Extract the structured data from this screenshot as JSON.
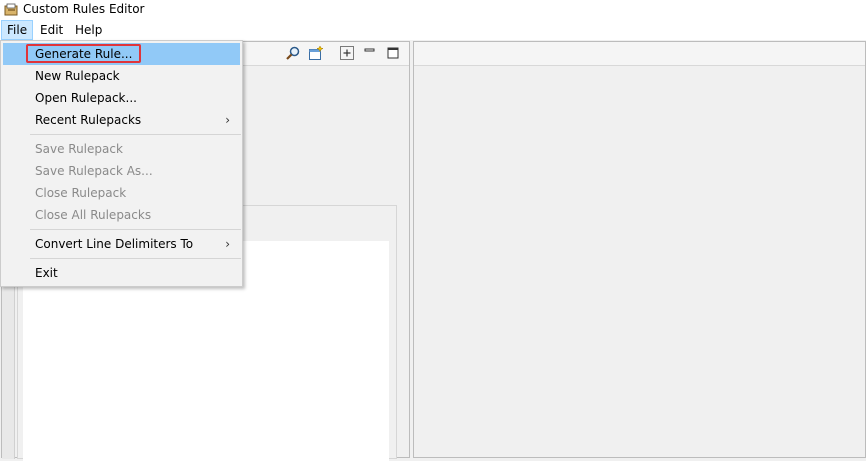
{
  "window": {
    "title": "Custom Rules Editor",
    "icon": "editor-app-icon"
  },
  "menubar": {
    "items": [
      "File",
      "Edit",
      "Help"
    ],
    "active": "File"
  },
  "toolbar": {
    "icons": [
      "search-icon",
      "new-window-icon",
      "maximize-icon",
      "minimize-icon",
      "restore-icon"
    ]
  },
  "file_menu": {
    "items": [
      {
        "label": "Generate Rule...",
        "enabled": true,
        "highlighted": true
      },
      {
        "label": "New Rulepack",
        "enabled": true
      },
      {
        "label": "Open Rulepack...",
        "enabled": true
      },
      {
        "label": "Recent Rulepacks",
        "enabled": true,
        "submenu": true
      },
      {
        "label": "Save Rulepack",
        "enabled": false
      },
      {
        "label": "Save Rulepack As...",
        "enabled": false
      },
      {
        "label": "Close Rulepack",
        "enabled": false
      },
      {
        "label": "Close All Rulepacks",
        "enabled": false
      },
      {
        "label": "Convert Line Delimiters To",
        "enabled": true,
        "submenu": true
      },
      {
        "label": "Exit",
        "enabled": true
      }
    ],
    "submenu_arrow": "›"
  },
  "colors": {
    "selection": "#91c9f7",
    "highlight_border": "#e0343a"
  }
}
